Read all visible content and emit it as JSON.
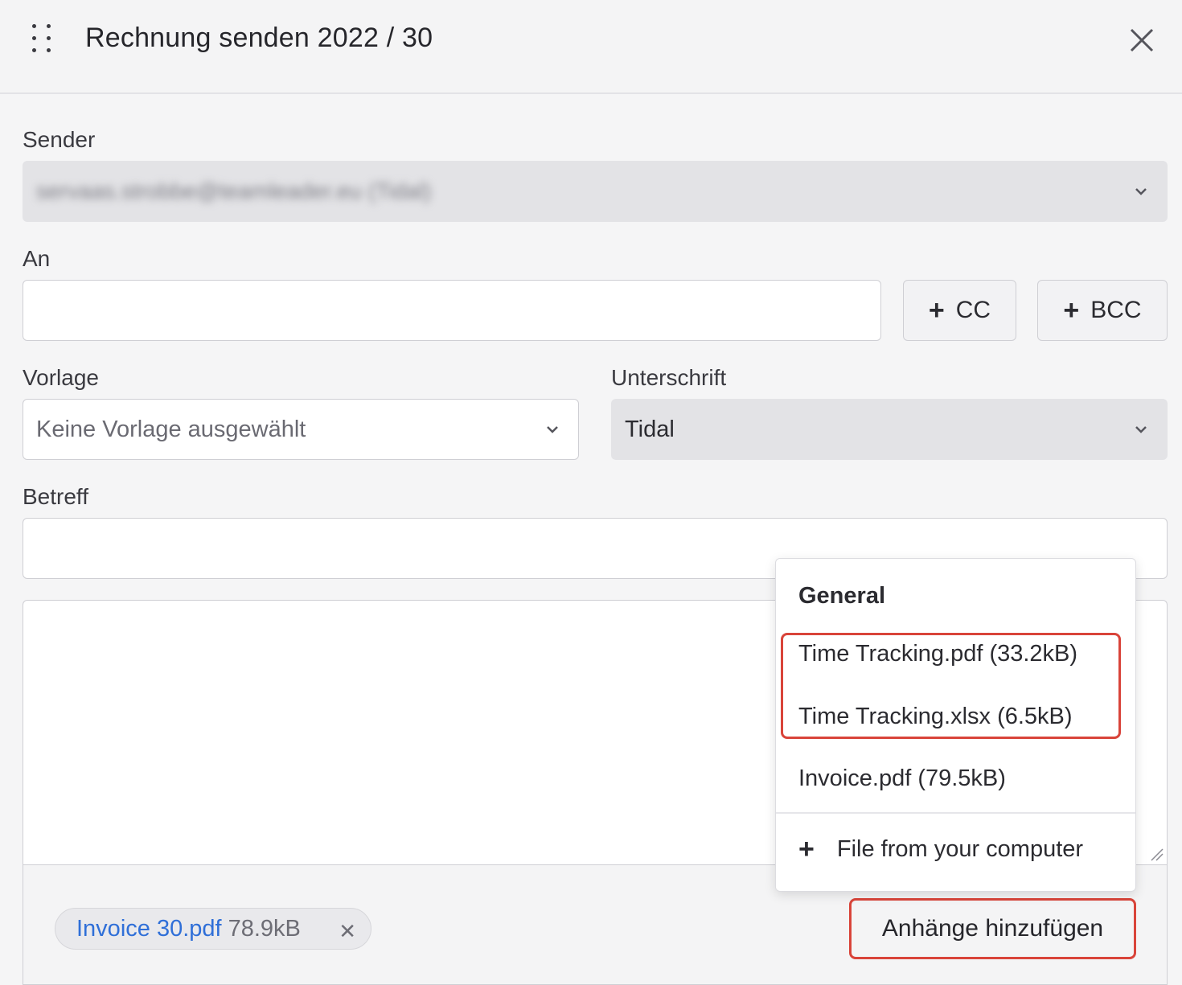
{
  "header": {
    "title": "Rechnung senden 2022 / 30"
  },
  "sender": {
    "label": "Sender",
    "value": "servaas.strobbe@teamleader.eu (Tidal)"
  },
  "recipient": {
    "label": "An",
    "value": "",
    "cc_label": "CC",
    "bcc_label": "BCC"
  },
  "template": {
    "label": "Vorlage",
    "placeholder": "Keine Vorlage ausgewählt"
  },
  "signature": {
    "label": "Unterschrift",
    "value": "Tidal"
  },
  "subject": {
    "label": "Betreff",
    "value": ""
  },
  "attachments": {
    "chip": {
      "name": "Invoice 30.pdf",
      "size": "78.9kB"
    },
    "add_button": "Anhänge hinzufügen"
  },
  "dropdown": {
    "heading": "General",
    "items": [
      "Time Tracking.pdf (33.2kB)",
      "Time Tracking.xlsx (6.5kB)",
      "Invoice.pdf (79.5kB)"
    ],
    "upload_label": "File from your computer"
  },
  "colors": {
    "highlight": "#d9443a",
    "link": "#2f6fd8",
    "disabled_bg": "#e3e3e6"
  }
}
